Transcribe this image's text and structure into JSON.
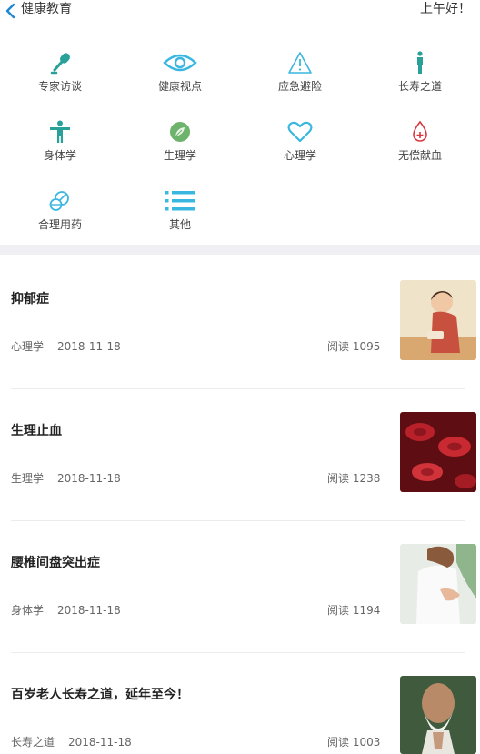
{
  "header": {
    "title": "健康教育",
    "greeting": "上午好！"
  },
  "categories": [
    {
      "label": "专家访谈",
      "icon": "microphone-icon"
    },
    {
      "label": "健康视点",
      "icon": "eye-icon"
    },
    {
      "label": "应急避险",
      "icon": "warning-icon"
    },
    {
      "label": "长寿之道",
      "icon": "person-standing-icon"
    },
    {
      "label": "身体学",
      "icon": "body-icon"
    },
    {
      "label": "生理学",
      "icon": "leaf-icon"
    },
    {
      "label": "心理学",
      "icon": "heart-icon"
    },
    {
      "label": "无偿献血",
      "icon": "blood-drop-icon"
    },
    {
      "label": "合理用药",
      "icon": "pills-icon"
    },
    {
      "label": "其他",
      "icon": "list-icon"
    }
  ],
  "articles": [
    {
      "title": "抑郁症",
      "category": "心理学",
      "date": "2018-11-18",
      "reads": "阅读 1095"
    },
    {
      "title": "生理止血",
      "category": "生理学",
      "date": "2018-11-18",
      "reads": "阅读 1238"
    },
    {
      "title": "腰椎间盘突出症",
      "category": "身体学",
      "date": "2018-11-18",
      "reads": "阅读 1194"
    },
    {
      "title": "百岁老人长寿之道，延年至今！",
      "category": "长寿之道",
      "date": "2018-11-18",
      "reads": "阅读 1003"
    }
  ],
  "colors": {
    "teal": "#2aa198",
    "sky": "#39b7e0",
    "green": "#6db36b",
    "red": "#d9363e",
    "separator": "#efeff4"
  }
}
